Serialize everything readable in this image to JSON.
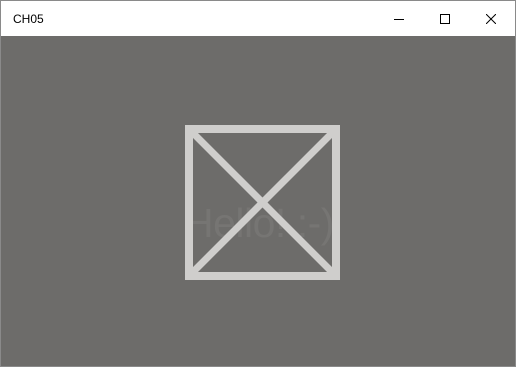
{
  "window": {
    "title": "CH05"
  },
  "caption_buttons": {
    "minimize_icon": "minimize-icon",
    "maximize_icon": "maximize-icon",
    "close_icon": "close-icon"
  },
  "content": {
    "text": "Hello! :-)",
    "image_icon": "image-placeholder-icon",
    "background_color": "#6d6c6a",
    "text_color": "#767573",
    "placeholder_color": "#cfcecc"
  }
}
